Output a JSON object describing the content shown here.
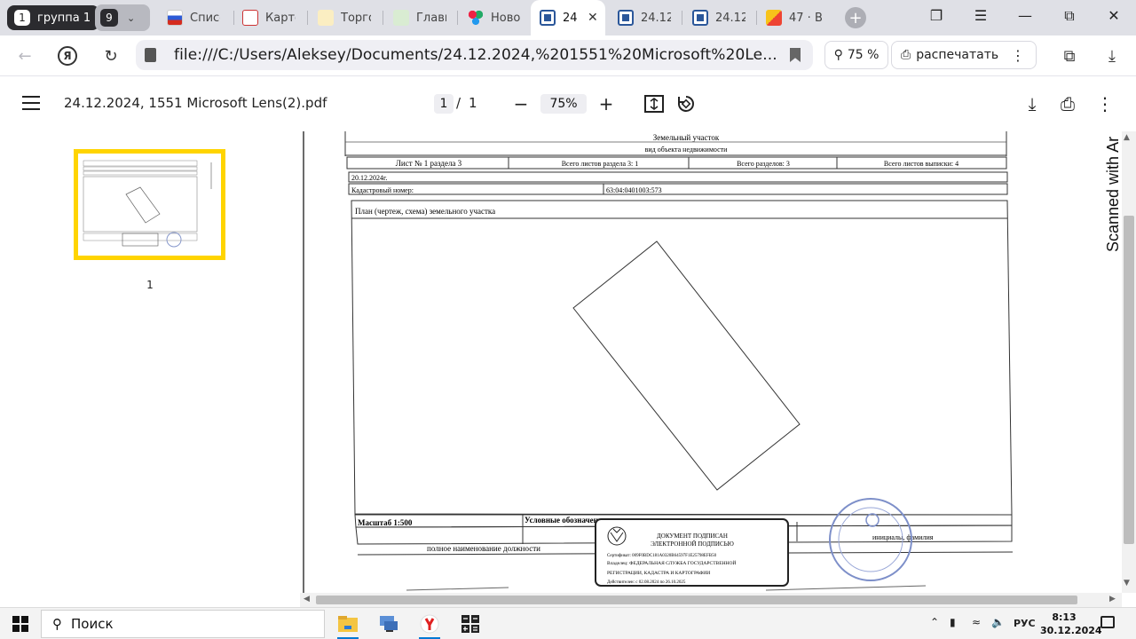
{
  "tabbar": {
    "group": {
      "index": "1",
      "name": "группа 1"
    },
    "group_count": "9",
    "tabs": [
      {
        "title": "Списо",
        "favicon": "flag-ru"
      },
      {
        "title": "Карто",
        "favicon": "gov-emblem"
      },
      {
        "title": "Торго",
        "favicon": "gavel"
      },
      {
        "title": "Главн",
        "favicon": "emblem-green"
      },
      {
        "title": "Ново",
        "favicon": "colored-dots"
      },
      {
        "title": "24",
        "favicon": "word-doc",
        "active": true
      },
      {
        "title": "24.12",
        "favicon": "word-doc"
      },
      {
        "title": "24.12",
        "favicon": "word-doc"
      },
      {
        "title": "47 · В",
        "favicon": "mail"
      }
    ]
  },
  "addressbar": {
    "url": "file:///C:/Users/Aleksey/Documents/24.12.2024,%201551%20Microsoft%20Le...",
    "zoom": "75 %",
    "print_label": "распечатать"
  },
  "pdf": {
    "filename": "24.12.2024, 1551 Microsoft Lens(2).pdf",
    "page_current": "1",
    "page_sep": "/",
    "page_total": "1",
    "zoom": "75%",
    "thumb_page_label": "1"
  },
  "document": {
    "header_object": "Земельный участок",
    "header_object_sub": "вид объекта недвижимости",
    "row_sheet": "Лист № 1 раздела 3",
    "row_total_sheets_section": "Всего листов раздела 3: 1",
    "row_total_sections": "Всего разделов: 3",
    "row_total_extract_sheets": "Всего листов выписки: 4",
    "date": "20.12.2024г.",
    "cadastral_label": "Кадастровый номер:",
    "cadastral_value": "63:04:0401003:573",
    "plan_title": "План (чертеж, схема) земельного участка",
    "scale": "Масштаб 1:500",
    "legend": "Условные обозначения:",
    "position_label": "полное наименование должности",
    "initials_label": "инициалы, фамилия",
    "stamp": {
      "line1": "ДОКУМЕНТ ПОДПИСАН",
      "line2": "ЭЛЕКТРОННОЙ ПОДПИСЬЮ",
      "cert": "Сертификат: 009F0BDC181A0320B64597F1E25798EFB50",
      "owner1": "Владелец: ФЕДЕРАЛЬНАЯ СЛУЖБА ГОСУДАРСТВЕННОЙ",
      "owner2": "РЕГИСТРАЦИИ, КАДАСТРА И КАРТОГРАФИИ",
      "valid": "Действителен: с 02.08.2024 по 26.10.2025"
    },
    "side_text": "Scanned with Ar"
  },
  "taskbar": {
    "search_label": "Поиск",
    "lang": "РУС",
    "time": "8:13",
    "date": "30.12.2024"
  }
}
